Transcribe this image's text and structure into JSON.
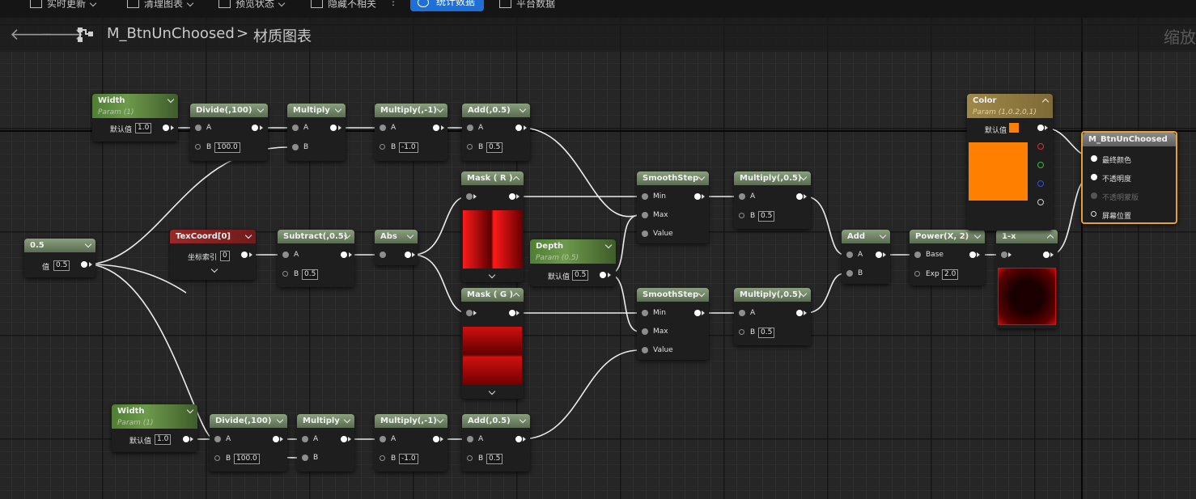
{
  "toolbar": {
    "live_update": "实时更新",
    "clean_graph": "清理图表",
    "preview_state": "预览状态",
    "hide_unrelated": "隐藏不相关",
    "stats": "统计数据",
    "platform_stats": "平台数据"
  },
  "breadcrumb": {
    "material": "M_BtnUnChoosed",
    "separator": ">",
    "graph": "材质图表"
  },
  "zoom_label": "缩放",
  "nodes": {
    "width1": {
      "title": "Width",
      "sub": "Param (1)",
      "default_label": "默认值",
      "value": "1.0"
    },
    "divide1": {
      "title": "Divide(,100)",
      "a": "A",
      "b": "B",
      "b_value": "100.0"
    },
    "multiply1": {
      "title": "Multiply",
      "a": "A",
      "b": "B"
    },
    "multneg1": {
      "title": "Multiply(,-1)",
      "a": "A",
      "b": "B",
      "b_value": "-1.0"
    },
    "add1": {
      "title": "Add(,0.5)",
      "a": "A",
      "b": "B",
      "b_value": "0.5"
    },
    "const05": {
      "title": "0.5",
      "label": "值",
      "value": "0.5"
    },
    "texcoord": {
      "title": "TexCoord[0]",
      "label": "坐标索引",
      "value": "0"
    },
    "subtract": {
      "title": "Subtract(,0.5)",
      "a": "A",
      "b": "B",
      "b_value": "0.5"
    },
    "abs": {
      "title": "Abs"
    },
    "maskr": {
      "title": "Mask ( R )"
    },
    "maskg": {
      "title": "Mask ( G )"
    },
    "depth": {
      "title": "Depth",
      "sub": "Param (0.5)",
      "default_label": "默认值",
      "value": "0.5"
    },
    "smooth1": {
      "title": "SmoothStep",
      "min": "Min",
      "max": "Max",
      "value": "Value"
    },
    "smooth2": {
      "title": "SmoothStep",
      "min": "Min",
      "max": "Max",
      "value": "Value"
    },
    "mult05a": {
      "title": "Multiply(,0.5)",
      "a": "A",
      "b": "B",
      "b_value": "0.5"
    },
    "mult05b": {
      "title": "Multiply(,0.5)",
      "a": "A",
      "b": "B",
      "b_value": "0.5"
    },
    "add": {
      "title": "Add",
      "a": "A",
      "b": "B"
    },
    "power": {
      "title": "Power(X, 2)",
      "base": "Base",
      "exp": "Exp",
      "exp_value": "2.0"
    },
    "oneminus": {
      "title": "1-x"
    },
    "color": {
      "title": "Color",
      "sub": "Param (1,0.2,0,1)",
      "default_label": "默认值"
    },
    "result": {
      "title": "M_BtnUnChoosed",
      "p1": "最终颜色",
      "p2": "不透明度",
      "p3": "不透明蒙版",
      "p4": "屏幕位置"
    },
    "width2": {
      "title": "Width",
      "sub": "Param (1)",
      "default_label": "默认值",
      "value": "1.0"
    },
    "divide2": {
      "title": "Divide(,100)",
      "a": "A",
      "b": "B",
      "b_value": "100.0"
    },
    "multiply2": {
      "title": "Multiply",
      "a": "A",
      "b": "B"
    },
    "multneg2": {
      "title": "Multiply(,-1)",
      "a": "A",
      "b": "B",
      "b_value": "-1.0"
    },
    "add2": {
      "title": "Add(,0.5)",
      "a": "A",
      "b": "B",
      "b_value": "0.5"
    }
  },
  "colors": {
    "accent": "#1f6fd6",
    "color_param": "#ff7f00",
    "result_border": "#e8a030",
    "wire": "#ececec"
  }
}
